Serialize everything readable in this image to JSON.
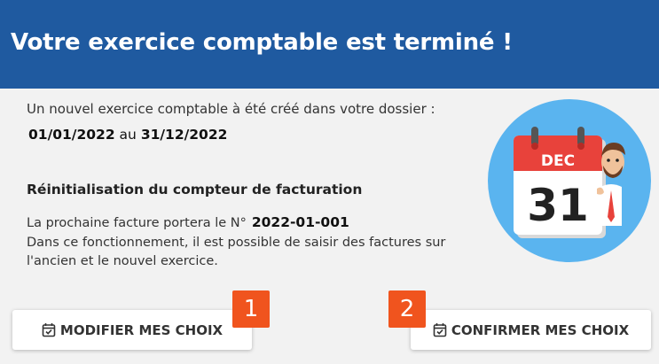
{
  "header": {
    "title": "Votre exercice comptable est terminé !"
  },
  "content": {
    "intro": "Un nouvel exercice comptable à été créé dans votre dossier :",
    "start_date": "01/01/2022",
    "date_separator": "au",
    "end_date": "31/12/2022",
    "section_title": "Réinitialisation du compteur de facturation",
    "next_invoice_label": "La prochaine facture portera le N°",
    "next_invoice_number": "2022-01-001",
    "explanation": "Dans ce fonctionnement, il est possible de saisir des factures sur l'ancien et le nouvel exercice."
  },
  "illustration": {
    "month": "DEC",
    "day": "31",
    "icon": "calendar-with-person"
  },
  "buttons": {
    "modify": {
      "label": "MODIFIER MES CHOIX",
      "icon": "calendar-check-icon"
    },
    "confirm": {
      "label": "CONFIRMER MES CHOIX",
      "icon": "calendar-check-icon"
    }
  },
  "badges": {
    "first": "1",
    "second": "2"
  },
  "colors": {
    "header": "#1f5aa0",
    "badge": "#f0541e",
    "calendar_red": "#e8423b",
    "circle": "#5ab4ef"
  }
}
